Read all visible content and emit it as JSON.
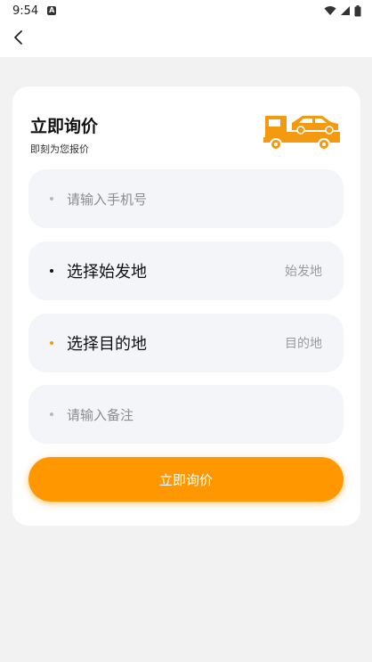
{
  "status_bar": {
    "time": "9:54",
    "notification_badge": "A"
  },
  "header": {
    "back_icon": "chevron-left-icon"
  },
  "card": {
    "title": "立即询价",
    "subtitle": "即刻为您报价",
    "illustration": "tow-truck-icon"
  },
  "fields": {
    "phone": {
      "placeholder": "请输入手机号"
    },
    "origin": {
      "label": "选择始发地",
      "hint": "始发地"
    },
    "destination": {
      "label": "选择目的地",
      "hint": "目的地"
    },
    "remark": {
      "placeholder": "请输入备注"
    }
  },
  "submit_label": "立即询价",
  "colors": {
    "accent": "#ff9800",
    "field_bg": "#f4f5f9",
    "page_bg": "#f2f2f2"
  }
}
